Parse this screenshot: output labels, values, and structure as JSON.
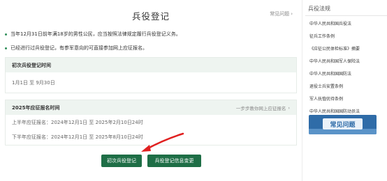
{
  "header": {
    "title": "兵役登记",
    "faq_link": "常见问题",
    "faq_chevron": "›"
  },
  "notices": [
    "当年12月31日前年满18岁的男性公民，应当按照法律规定履行兵役登记义务。",
    "已经进行过兵役登记，有参军意向的可直接参加网上应征报名。"
  ],
  "initial_registration": {
    "title": "初次兵役登记时间",
    "period": "1月1日 至 9月30日"
  },
  "enlistment": {
    "title": "2025年应征报名时间",
    "link": "一步步教你网上应征报名",
    "link_chevron": "›",
    "first_half": "上半年应征报名：2024年12月1日 至 2025年2月10日24时",
    "second_half": "下半年应征报名：2024年12月1日 至 2025年8月10日24时"
  },
  "buttons": {
    "initial": "初次兵役登记",
    "change": "兵役登记信息变更"
  },
  "sidebar": {
    "title": "兵役法规",
    "laws": [
      "中华人民共和国兵役法",
      "征兵工作条例",
      "《应征公民体检标准》摘要",
      "中华人民共和国军人保险法",
      "中华人民共和国国防法",
      "退役士兵安置条例",
      "军人抚恤优待条例",
      "中华人民共和国国防动员法"
    ],
    "banner": "常见问题"
  },
  "colors": {
    "primary_green": "#1e6e46",
    "panel_header_bg": "#eef4f0",
    "arrow_red": "#e02020",
    "banner_blue": "#2f6ca8"
  }
}
